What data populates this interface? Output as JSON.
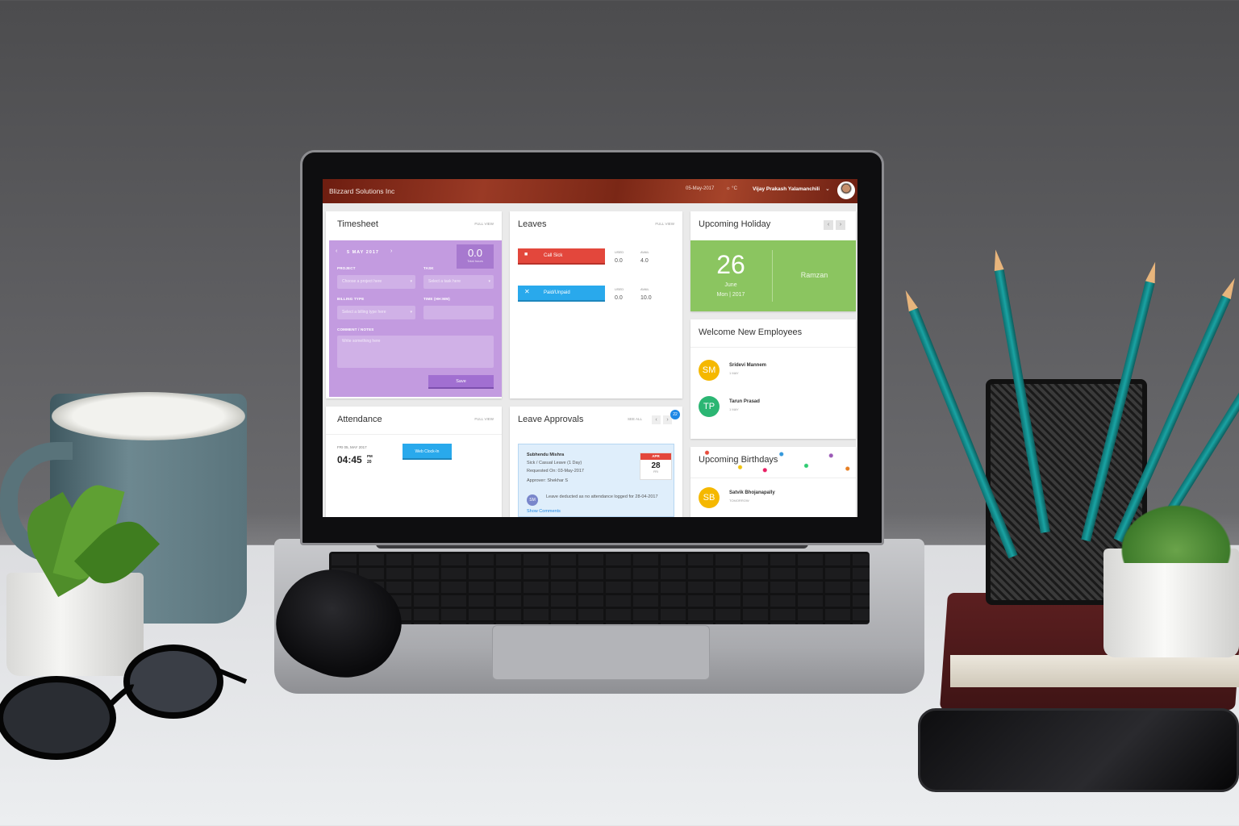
{
  "app": {
    "company": "Blizzard Solutions Inc",
    "date": "05-May-2017",
    "temperature": "°C",
    "user_name": "Vijay Prakash Yalamanchili"
  },
  "timesheet": {
    "title": "Timesheet",
    "full_view": "FULL VIEW",
    "date_label": "5 MAY 2017",
    "total_hours_value": "0.0",
    "total_hours_label": "Total hours",
    "project_label": "PROJECT",
    "project_placeholder": "Choose a project here",
    "task_label": "TASK",
    "task_placeholder": "Select a task here",
    "billing_label": "BILLING TYPE",
    "billing_placeholder": "Select a billing type here",
    "time_label": "TIME (HH:MM)",
    "comment_label": "COMMENT / NOTES",
    "comment_placeholder": "Write something here",
    "save_label": "Save"
  },
  "leaves": {
    "title": "Leaves",
    "full_view": "FULL VIEW",
    "items": [
      {
        "label": "Call Sick",
        "used_label": "USED",
        "used": "0.0",
        "avail_label": "AVAIL",
        "avail": "4.0",
        "color": "#e3473c"
      },
      {
        "label": "Paid/Unpaid",
        "used_label": "USED",
        "used": "0.0",
        "avail_label": "AVAIL",
        "avail": "10.0",
        "color": "#29a9ec"
      }
    ]
  },
  "holiday": {
    "title": "Upcoming Holiday",
    "day": "26",
    "month": "June",
    "weekday_year": "Mon | 2017",
    "name": "Ramzan",
    "color": "#8bc560"
  },
  "new_employees": {
    "title": "Welcome New Employees",
    "items": [
      {
        "initials": "SM",
        "name": "Sridevi Mannem",
        "date": "1 MAY",
        "color": "#f5b800"
      },
      {
        "initials": "TP",
        "name": "Tarun Prasad",
        "date": "1 MAY",
        "color": "#2bb673"
      }
    ]
  },
  "attendance": {
    "title": "Attendance",
    "full_view": "FULL VIEW",
    "date": "FRI 05, MAY 2017",
    "time": "04:45",
    "ampm": "PM",
    "seconds": "20",
    "clock_in_label": "Web Clock-In"
  },
  "leave_approvals": {
    "title": "Leave Approvals",
    "see_all": "SEE ALL",
    "badge": "22",
    "request": {
      "name": "Subhendu Mishra",
      "type": "Sick / Casual Leave (1 Day)",
      "requested": "Requested On: 03-May-2017",
      "approver": "Approver: Shekhar S",
      "cal_month": "APR",
      "cal_day": "28",
      "cal_weekday": "FRI",
      "note_initials": "SM",
      "note": "Leave deducted as no attendance logged for 28-04-2017",
      "show_comments": "Show Comments"
    }
  },
  "birthdays": {
    "title": "Upcoming Birthdays",
    "items": [
      {
        "initials": "SB",
        "name": "Satvik Bhojanapally",
        "when": "TOMORROW",
        "color": "#f5b800"
      }
    ]
  }
}
